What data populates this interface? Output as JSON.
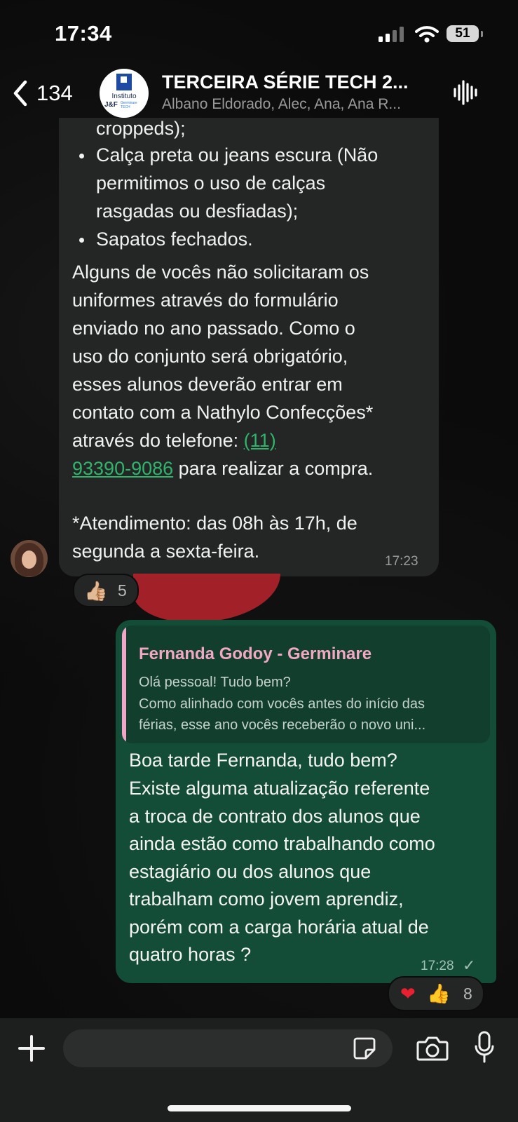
{
  "status_bar": {
    "time": "17:34",
    "battery": "51"
  },
  "header": {
    "back_count": "134",
    "group_title": "TERCEIRA SÉRIE TECH 2...",
    "members": "Albano Eldorado, Alec, Ana, Ana R...",
    "avatar": {
      "line1": "Instituto",
      "line2": "J&F",
      "line3": "Germinare TECH"
    }
  },
  "incoming_message": {
    "bullet_items": [
      {
        "lines": [
          "croppeds);"
        ]
      },
      {
        "lines": [
          "Calça preta ou jeans escura (Não",
          "permitimos o uso de calças",
          "rasgadas ou desfiadas);"
        ]
      },
      {
        "lines": [
          "Sapatos fechados."
        ]
      }
    ],
    "paragraph_lines": [
      "Alguns de vocês não solicitaram os",
      "uniformes através do formulário",
      "enviado no ano passado. Como o",
      "uso do conjunto será obrigatório,",
      "esses alunos deverão entrar em",
      "contato com a Nathylo Confecções*"
    ],
    "phone_prefix": "através do telefone: ",
    "phone_part1": "(11)",
    "phone_part2": "93390-9086",
    "phone_suffix": " para realizar a compra.",
    "note_lines": [
      "*Atendimento: das 08h às 17h, de",
      "segunda a sexta-feira."
    ],
    "time": "17:23",
    "reaction": {
      "emoji": "👍🏼",
      "count": "5"
    }
  },
  "outgoing_message": {
    "quote": {
      "author": "Fernanda Godoy - Germinare",
      "lines": [
        "Olá pessoal! Tudo bem?",
        "Como alinhado com vocês antes do início das",
        "férias, esse ano vocês receberão o novo uni..."
      ]
    },
    "lines": [
      "Boa tarde Fernanda, tudo bem?",
      "Existe alguma atualização referente",
      "a troca de contrato dos alunos que",
      "ainda estão como trabalhando como",
      "estagiário ou dos alunos que",
      "trabalham como jovem aprendiz,",
      "porém com a carga horária atual de",
      "quatro horas ?"
    ],
    "time": "17:28",
    "tick": "✓",
    "reaction": {
      "emoji1": "❤",
      "emoji2": "👍",
      "count": "8"
    }
  },
  "composer": {
    "input_value": "",
    "icons": [
      "plus-icon",
      "sticker-icon",
      "camera-icon",
      "microphone-icon"
    ]
  },
  "colors": {
    "incoming_bubble": "#242626",
    "outgoing_bubble": "#144d37",
    "link": "#2fb56b",
    "quote_author": "#f2a7c3"
  }
}
